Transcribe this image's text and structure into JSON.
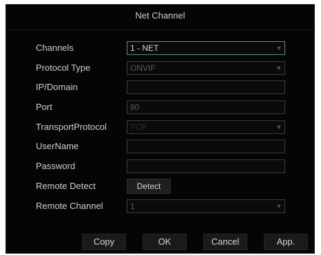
{
  "dialog": {
    "title": "Net Channel"
  },
  "form": {
    "channels": {
      "label": "Channels",
      "value": "1 - NET"
    },
    "protocol_type": {
      "label": "Protocol Type",
      "value": "ONVIF"
    },
    "ip_domain": {
      "label": "IP/Domain",
      "value": ""
    },
    "port": {
      "label": "Port",
      "value": "80"
    },
    "transport_protocol": {
      "label": "TransportProtocol",
      "value": "TCP"
    },
    "username": {
      "label": "UserName",
      "value": ""
    },
    "password": {
      "label": "Password",
      "value": ""
    },
    "remote_detect": {
      "label": "Remote Detect",
      "button_label": "Detect"
    },
    "remote_channel": {
      "label": "Remote Channel",
      "value": "1"
    }
  },
  "icons": {
    "dropdown_arrow": "chevron-down-icon",
    "dropdown_glyph": "▼"
  },
  "buttons": {
    "copy": "Copy",
    "ok": "OK",
    "cancel": "Cancel",
    "apply": "App."
  },
  "colors": {
    "background": "#050505",
    "text": "#cfcfcf",
    "field_border": "#3c3c3c",
    "selected_border": "#5f8f95"
  }
}
